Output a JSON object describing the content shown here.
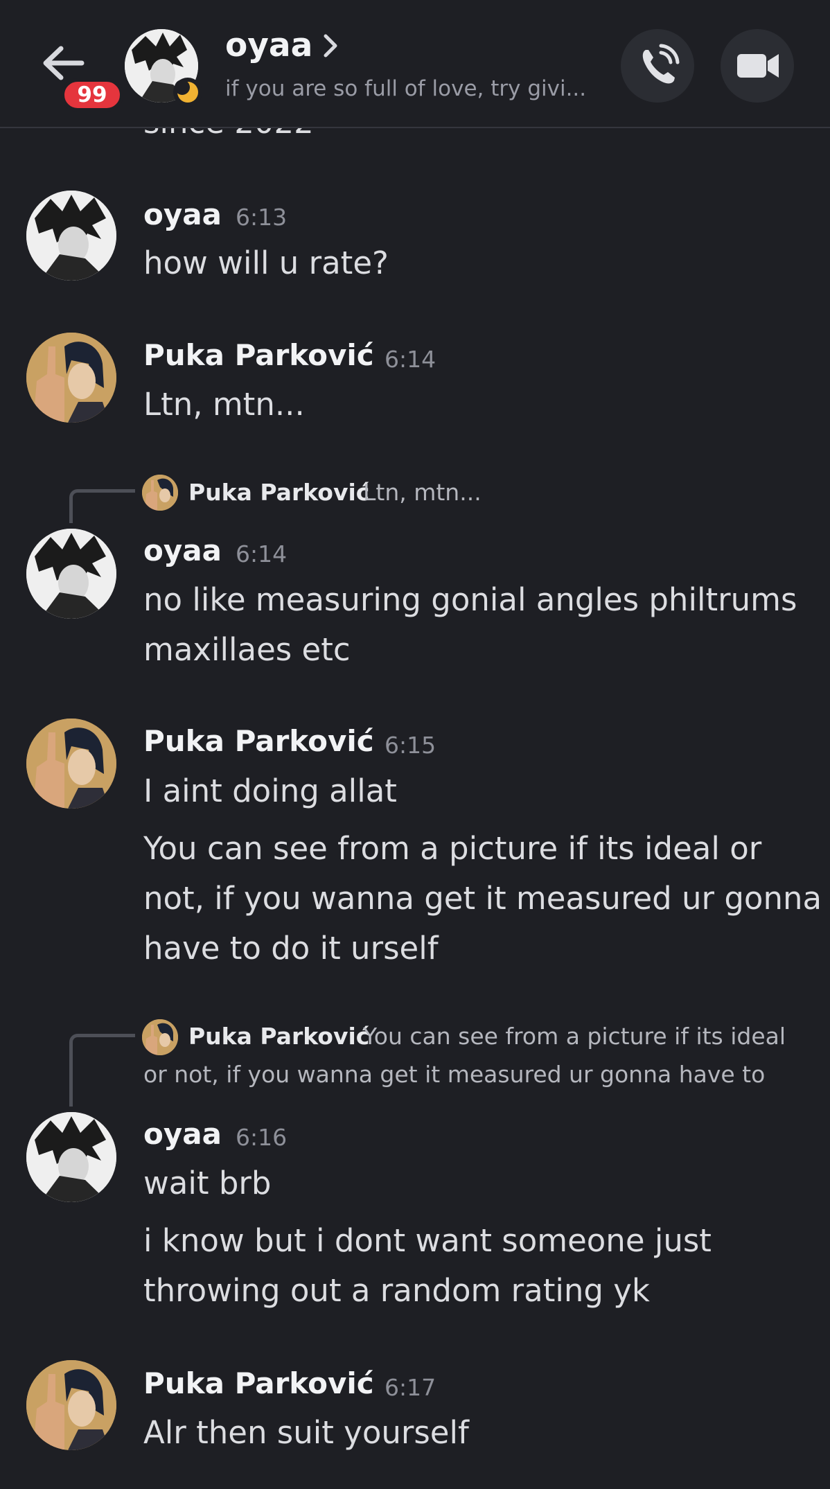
{
  "header": {
    "unread_badge": "99",
    "name": "oyaa",
    "status": "if you are so full of love, try givi..."
  },
  "clipped_previous_text": "since 2022",
  "messages": [
    {
      "author": "oyaa",
      "time": "6:13",
      "lines": [
        "how will u rate?"
      ]
    },
    {
      "author": "Puka Parković",
      "time": "6:14",
      "lines": [
        "Ltn, mtn..."
      ]
    },
    {
      "reply": {
        "author": "Puka Parković",
        "text": "Ltn, mtn..."
      },
      "author": "oyaa",
      "time": "6:14",
      "lines": [
        "no like measuring gonial angles philtrums",
        "maxillaes etc"
      ]
    },
    {
      "author": "Puka Parković",
      "time": "6:15",
      "lines": [
        "I aint doing allat"
      ],
      "lines2": [
        "You can see from a picture if its ideal or",
        "not, if you wanna get it measured ur gonna",
        "have to do it urself"
      ]
    },
    {
      "reply": {
        "author": "Puka Parković",
        "text": "You can see from a picture if its ideal",
        "text2": "or not, if you wanna get it measured ur gonna have to"
      },
      "author": "oyaa",
      "time": "6:16",
      "lines": [
        "wait brb"
      ],
      "lines2": [
        "i know but i dont want someone just",
        "throwing out a random rating yk"
      ]
    },
    {
      "author": "Puka Parković",
      "time": "6:17",
      "lines": [
        "Alr then suit yourself"
      ]
    }
  ]
}
